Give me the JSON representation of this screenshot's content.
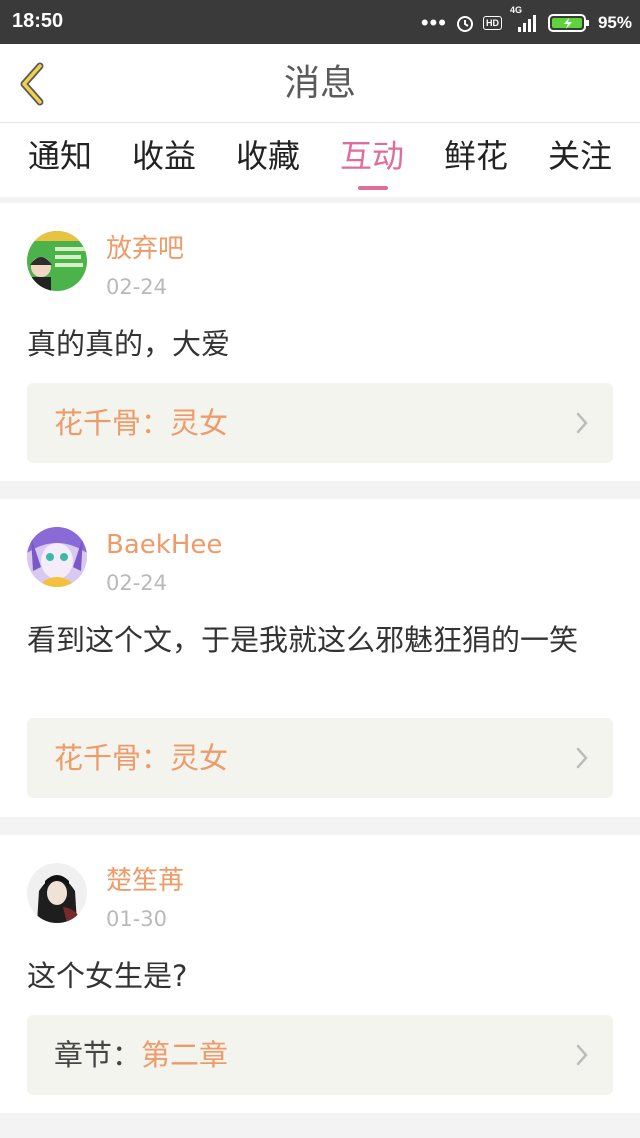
{
  "status": {
    "time": "18:50",
    "network": "4G",
    "hd_badge": "HD",
    "battery_pct": "95%"
  },
  "header": {
    "title": "消息"
  },
  "tabs": [
    {
      "label": "通知"
    },
    {
      "label": "收益"
    },
    {
      "label": "收藏"
    },
    {
      "label": "互动",
      "active": true
    },
    {
      "label": "鲜花"
    },
    {
      "label": "关注"
    }
  ],
  "items": [
    {
      "user": "放弃吧",
      "date": "02-24",
      "content": "真的真的，大爱",
      "ref_label": "花千骨：",
      "ref_title": "灵女"
    },
    {
      "user": "BaekHee",
      "date": "02-24",
      "content": "看到这个文，于是我就这么邪魅狂狷的一笑",
      "ref_label": "花千骨：",
      "ref_title": "灵女"
    },
    {
      "user": "楚笙苒",
      "date": "01-30",
      "content": "这个女生是?",
      "ref_label": "章节：",
      "ref_title": "第二章"
    }
  ],
  "colors": {
    "accent_pink": "#e06c9b",
    "username_orange": "#ee9b6a",
    "statusbar": "#3a3a3a"
  }
}
